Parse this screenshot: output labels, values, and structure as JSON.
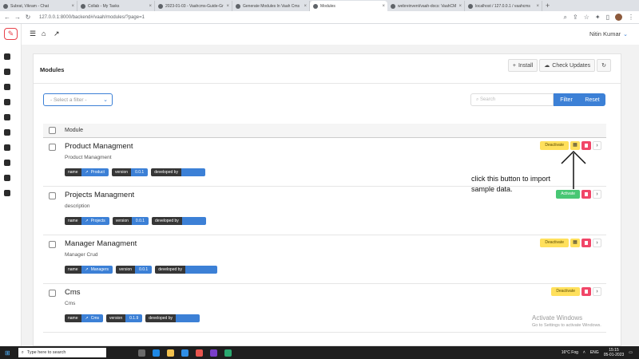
{
  "browser": {
    "tabs": [
      {
        "label": "Subrat, Vikram - Chat",
        "active": false
      },
      {
        "label": "Collab - My Tasks",
        "active": false
      },
      {
        "label": "2023-01-03 - Vaahcms-Guide-Gr",
        "active": false
      },
      {
        "label": "Generate Modules In Vaah Cms",
        "active": false
      },
      {
        "label": "Modules",
        "active": true
      },
      {
        "label": "webreinvent/vaah-docs: VaahCM",
        "active": false
      },
      {
        "label": "localhost / 127.0.0.1 / vaahcms",
        "active": false
      }
    ],
    "new_tab": "+",
    "url": "127.0.0.1:8000/backend#/vaah/modules/?page=1"
  },
  "topbar": {
    "user_name": "Nitin Kumar"
  },
  "panel": {
    "title": "Modules",
    "install_label": "Install",
    "check_updates_label": "Check Updates"
  },
  "filters": {
    "select_placeholder": "- Select a filter -",
    "search_placeholder": "Search",
    "filter_label": "Filter",
    "reset_label": "Reset"
  },
  "table": {
    "column_header": "Module",
    "rows": [
      {
        "name": "Product Managment",
        "description": "Product Managment",
        "name_tag_value": "Product",
        "version": "0.0.1",
        "status_action": "Deactivate",
        "has_seed_button": true
      },
      {
        "name": "Projects Managment",
        "description": "description",
        "name_tag_value": "Projects",
        "version": "0.0.1",
        "status_action": "Activate",
        "has_seed_button": false
      },
      {
        "name": "Manager Managment",
        "description": "Manager Crud",
        "name_tag_value": "Managers",
        "version": "0.0.1",
        "status_action": "Deactivate",
        "has_seed_button": true
      },
      {
        "name": "Cms",
        "description": "Cms",
        "name_tag_value": "Cms",
        "version": "0.1.9",
        "status_action": "Deactivate",
        "has_seed_button": false
      }
    ],
    "tag_keys": {
      "name": "name",
      "version": "version",
      "developed_by": "developed by"
    }
  },
  "annotation": {
    "text_line1": "click this button to import",
    "text_line2": "sample data."
  },
  "watermark": {
    "line1": "Activate Windows",
    "line2": "Go to Settings to activate Windows."
  },
  "taskbar": {
    "search_placeholder": "Type here to search",
    "weather": "16°C Fog",
    "language": "ENG",
    "time": "15:15",
    "date": "05-01-2023"
  },
  "colors": {
    "primary": "#3c80d6",
    "warning": "#ffe05c",
    "success": "#48c774",
    "danger": "#f14668",
    "dark_tag": "#363636"
  }
}
